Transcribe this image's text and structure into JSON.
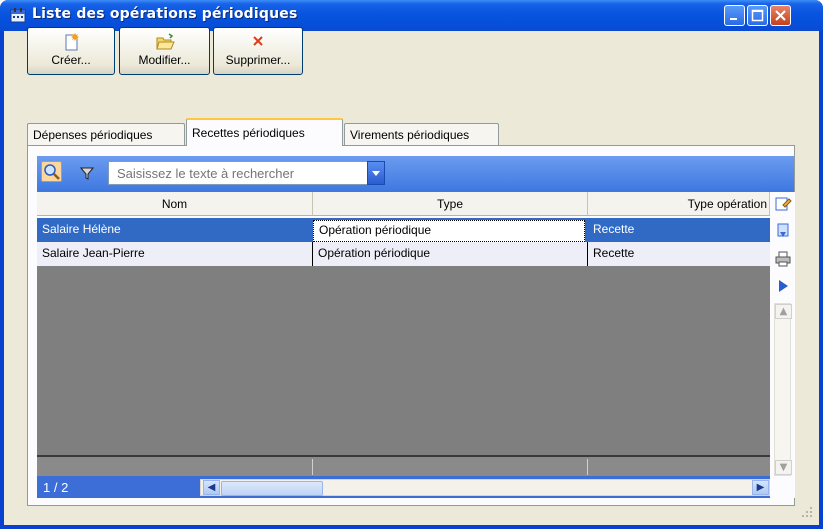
{
  "window": {
    "title": "Liste des opérations périodiques",
    "controls": [
      "minimize",
      "maximize",
      "close"
    ]
  },
  "toolbar": {
    "create_label": "Créer...",
    "modify_label": "Modifier...",
    "delete_label": "Supprimer..."
  },
  "tabs": [
    {
      "label": "Dépenses périodiques",
      "active": false
    },
    {
      "label": "Recettes périodiques",
      "active": true
    },
    {
      "label": "Virements périodiques",
      "active": false
    }
  ],
  "search": {
    "value": "",
    "placeholder": "Saisissez le texte à rechercher"
  },
  "table": {
    "columns": [
      "Nom",
      "Type",
      "Type opération"
    ],
    "rows": [
      {
        "nom": "Salaire Hélène",
        "type": "Opération périodique",
        "type_operation": "Recette",
        "selected": true
      },
      {
        "nom": "Salaire Jean-Pierre",
        "type": "Opération périodique",
        "type_operation": "Recette",
        "selected": false
      }
    ]
  },
  "status": {
    "page_indicator": "1 / 2"
  },
  "colors": {
    "titlebar": "#0a56e0",
    "selection": "#316ac5",
    "active_tab_accent": "#ffc83c",
    "empty_grid": "#7f7f7f"
  },
  "icons": {
    "app": "calendar-icon",
    "create": "new-document-icon",
    "modify": "open-folder-icon",
    "delete": "red-x-icon",
    "search": "magnifier-icon",
    "filter": "funnel-icon",
    "side": [
      "edit-column-icon",
      "export-icon",
      "print-icon",
      "play-icon"
    ]
  }
}
